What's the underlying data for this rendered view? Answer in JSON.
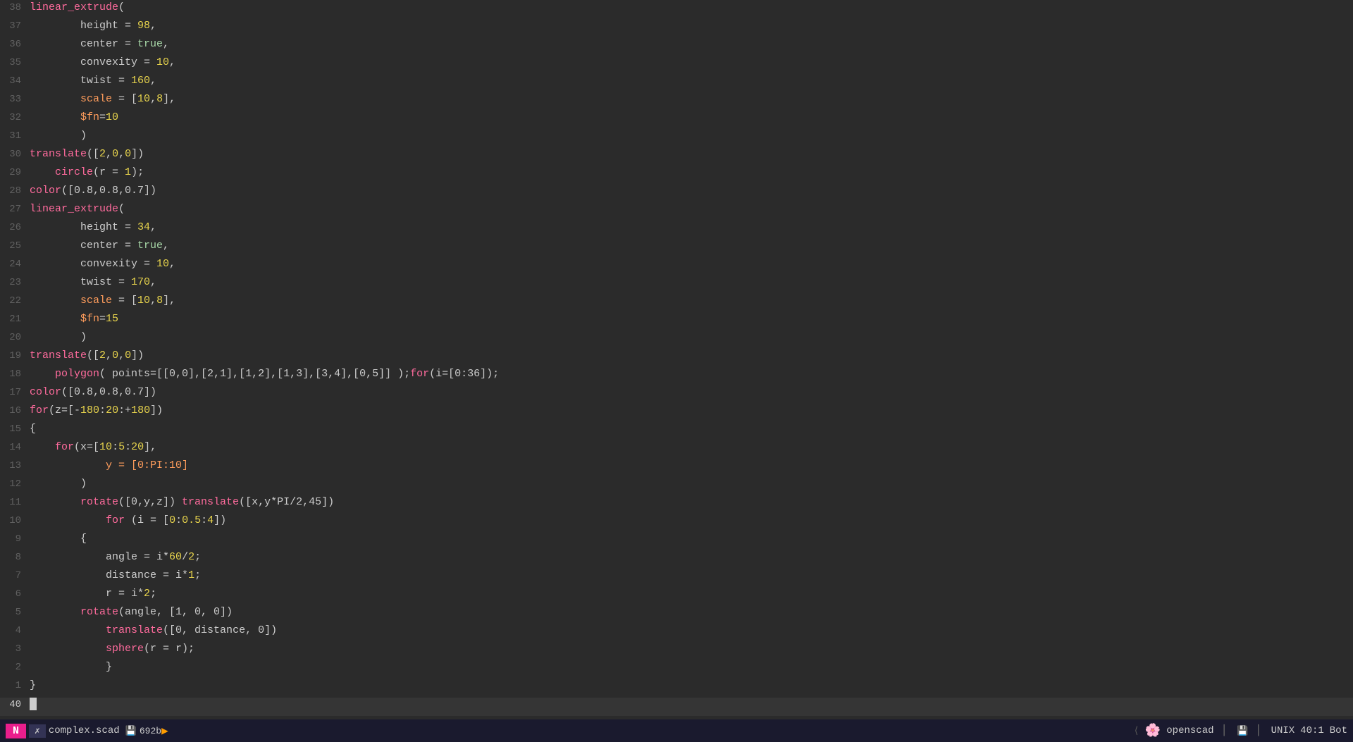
{
  "editor": {
    "background": "#2b2b2b",
    "lines": [
      {
        "num": 1,
        "content": [
          {
            "text": "}",
            "class": "kw-paren"
          }
        ]
      },
      {
        "num": 2,
        "content": [
          {
            "text": "        }",
            "class": "kw-paren"
          }
        ]
      },
      {
        "num": 3,
        "content": [
          {
            "text": "        ",
            "class": "kw-normal"
          },
          {
            "text": "sphere",
            "class": "kw-func"
          },
          {
            "text": "(r = r);",
            "class": "kw-normal"
          }
        ]
      },
      {
        "num": 4,
        "content": [
          {
            "text": "        ",
            "class": "kw-normal"
          },
          {
            "text": "translate",
            "class": "kw-func"
          },
          {
            "text": "([0, distance, 0])",
            "class": "kw-normal"
          }
        ]
      },
      {
        "num": 5,
        "content": [
          {
            "text": "    ",
            "class": "kw-normal"
          },
          {
            "text": "rotate",
            "class": "kw-func"
          },
          {
            "text": "(angle, [1, 0, 0])",
            "class": "kw-normal"
          }
        ]
      },
      {
        "num": 6,
        "content": [
          {
            "text": "        r = i",
            "class": "kw-normal"
          },
          {
            "text": "*",
            "class": "kw-normal"
          },
          {
            "text": "2",
            "class": "kw-val-num"
          },
          {
            "text": ";",
            "class": "kw-normal"
          }
        ]
      },
      {
        "num": 7,
        "content": [
          {
            "text": "        distance = i",
            "class": "kw-normal"
          },
          {
            "text": "*",
            "class": "kw-normal"
          },
          {
            "text": "1",
            "class": "kw-val-num"
          },
          {
            "text": ";",
            "class": "kw-normal"
          }
        ]
      },
      {
        "num": 8,
        "content": [
          {
            "text": "        angle = i",
            "class": "kw-normal"
          },
          {
            "text": "*",
            "class": "kw-normal"
          },
          {
            "text": "60",
            "class": "kw-val-num"
          },
          {
            "text": "/",
            "class": "kw-normal"
          },
          {
            "text": "2",
            "class": "kw-val-num"
          },
          {
            "text": ";",
            "class": "kw-normal"
          }
        ]
      },
      {
        "num": 9,
        "content": [
          {
            "text": "        {",
            "class": "kw-paren"
          }
        ]
      },
      {
        "num": 10,
        "content": [
          {
            "text": "            ",
            "class": "kw-normal"
          },
          {
            "text": "for",
            "class": "kw-func"
          },
          {
            "text": " (i = [",
            "class": "kw-normal"
          },
          {
            "text": "0",
            "class": "kw-val-num"
          },
          {
            "text": ":",
            "class": "kw-normal"
          },
          {
            "text": "0.5",
            "class": "kw-val-num"
          },
          {
            "text": ":",
            "class": "kw-normal"
          },
          {
            "text": "4",
            "class": "kw-val-num"
          },
          {
            "text": "])",
            "class": "kw-normal"
          }
        ]
      },
      {
        "num": 11,
        "content": [
          {
            "text": "        ",
            "class": "kw-normal"
          },
          {
            "text": "rotate",
            "class": "kw-func"
          },
          {
            "text": "([0,y,z]) ",
            "class": "kw-normal"
          },
          {
            "text": "translate",
            "class": "kw-func"
          },
          {
            "text": "([x,y*PI/2,45])",
            "class": "kw-normal"
          }
        ]
      },
      {
        "num": 12,
        "content": [
          {
            "text": "    )",
            "class": "kw-paren"
          }
        ]
      },
      {
        "num": 13,
        "content": [
          {
            "text": "        y = [0:PI:10]",
            "class": "kw-special"
          }
        ]
      },
      {
        "num": 14,
        "content": [
          {
            "text": "    ",
            "class": "kw-normal"
          },
          {
            "text": "for",
            "class": "kw-func"
          },
          {
            "text": "(x=[",
            "class": "kw-normal"
          },
          {
            "text": "10",
            "class": "kw-val-num"
          },
          {
            "text": ":",
            "class": "kw-normal"
          },
          {
            "text": "5",
            "class": "kw-val-num"
          },
          {
            "text": ":",
            "class": "kw-normal"
          },
          {
            "text": "20",
            "class": "kw-val-num"
          },
          {
            "text": "],",
            "class": "kw-normal"
          }
        ]
      },
      {
        "num": 15,
        "content": [
          {
            "text": "{",
            "class": "kw-paren"
          }
        ]
      },
      {
        "num": 16,
        "content": [
          {
            "text": "for",
            "class": "kw-func"
          },
          {
            "text": "(z=[-",
            "class": "kw-normal"
          },
          {
            "text": "180",
            "class": "kw-val-num"
          },
          {
            "text": ":",
            "class": "kw-normal"
          },
          {
            "text": "20",
            "class": "kw-val-num"
          },
          {
            "text": ":+",
            "class": "kw-normal"
          },
          {
            "text": "180",
            "class": "kw-val-num"
          },
          {
            "text": "])",
            "class": "kw-normal"
          }
        ]
      },
      {
        "num": 17,
        "content": [
          {
            "text": "color",
            "class": "kw-func"
          },
          {
            "text": "([0.8,0.8,0.7])",
            "class": "kw-normal"
          }
        ]
      },
      {
        "num": 18,
        "content": [
          {
            "text": "    ",
            "class": "kw-normal"
          },
          {
            "text": "polygon",
            "class": "kw-func"
          },
          {
            "text": "( points=[[0,0],[2,1],[1,2],[1,3],[3,4],[0,5]] );",
            "class": "kw-normal"
          },
          {
            "text": "for",
            "class": "kw-func"
          },
          {
            "text": "(i=[0:36]);",
            "class": "kw-normal"
          }
        ]
      },
      {
        "num": 19,
        "content": [
          {
            "text": "translate",
            "class": "kw-func"
          },
          {
            "text": "([2,0,0])",
            "class": "kw-normal"
          }
        ]
      },
      {
        "num": 20,
        "content": [
          {
            "text": "    )",
            "class": "kw-paren"
          }
        ]
      },
      {
        "num": 21,
        "content": [
          {
            "text": "        ",
            "class": "kw-normal"
          },
          {
            "text": "$fn",
            "class": "kw-var"
          },
          {
            "text": "=",
            "class": "kw-equals"
          },
          {
            "text": "15",
            "class": "kw-val-num"
          }
        ]
      },
      {
        "num": 22,
        "content": [
          {
            "text": "        ",
            "class": "kw-normal"
          },
          {
            "text": "scale",
            "class": "kw-prop"
          },
          {
            "text": " = [",
            "class": "kw-normal"
          },
          {
            "text": "10",
            "class": "kw-val-num"
          },
          {
            "text": ",",
            "class": "kw-normal"
          },
          {
            "text": "8",
            "class": "kw-val-num"
          },
          {
            "text": "],",
            "class": "kw-normal"
          }
        ]
      },
      {
        "num": 23,
        "content": [
          {
            "text": "        ",
            "class": "kw-normal"
          },
          {
            "text": "twist",
            "class": "kw-prop"
          },
          {
            "text": " = ",
            "class": "kw-normal"
          },
          {
            "text": "170",
            "class": "kw-val-num"
          },
          {
            "text": ",",
            "class": "kw-normal"
          }
        ]
      },
      {
        "num": 24,
        "content": [
          {
            "text": "        ",
            "class": "kw-normal"
          },
          {
            "text": "convexity",
            "class": "kw-prop"
          },
          {
            "text": " = ",
            "class": "kw-normal"
          },
          {
            "text": "10",
            "class": "kw-val-num"
          },
          {
            "text": ",",
            "class": "kw-normal"
          }
        ]
      },
      {
        "num": 25,
        "content": [
          {
            "text": "        ",
            "class": "kw-normal"
          },
          {
            "text": "center",
            "class": "kw-prop"
          },
          {
            "text": " = ",
            "class": "kw-normal"
          },
          {
            "text": "true",
            "class": "kw-val-true"
          },
          {
            "text": ",",
            "class": "kw-normal"
          }
        ]
      },
      {
        "num": 26,
        "content": [
          {
            "text": "        ",
            "class": "kw-normal"
          },
          {
            "text": "height",
            "class": "kw-prop"
          },
          {
            "text": " = ",
            "class": "kw-normal"
          },
          {
            "text": "34",
            "class": "kw-val-num"
          },
          {
            "text": ",",
            "class": "kw-normal"
          }
        ]
      },
      {
        "num": 27,
        "content": [
          {
            "text": "linear_extrude",
            "class": "kw-func"
          },
          {
            "text": "(",
            "class": "kw-paren"
          }
        ]
      },
      {
        "num": 28,
        "content": [
          {
            "text": "color",
            "class": "kw-func"
          },
          {
            "text": "([0.8,0.8,0.7])",
            "class": "kw-normal"
          }
        ]
      },
      {
        "num": 29,
        "content": [
          {
            "text": "    ",
            "class": "kw-normal"
          },
          {
            "text": "circle",
            "class": "kw-func"
          },
          {
            "text": "(r = ",
            "class": "kw-normal"
          },
          {
            "text": "1",
            "class": "kw-val-num"
          },
          {
            "text": ");",
            "class": "kw-normal"
          }
        ]
      },
      {
        "num": 30,
        "content": [
          {
            "text": "translate",
            "class": "kw-func"
          },
          {
            "text": "([",
            "class": "kw-normal"
          },
          {
            "text": "2",
            "class": "kw-val-num"
          },
          {
            "text": ",",
            "class": "kw-normal"
          },
          {
            "text": "0",
            "class": "kw-val-num"
          },
          {
            "text": ",",
            "class": "kw-normal"
          },
          {
            "text": "0",
            "class": "kw-val-num"
          },
          {
            "text": "])",
            "class": "kw-normal"
          }
        ]
      },
      {
        "num": 31,
        "content": [
          {
            "text": "    )",
            "class": "kw-paren"
          }
        ]
      },
      {
        "num": 32,
        "content": [
          {
            "text": "        ",
            "class": "kw-normal"
          },
          {
            "text": "$fn",
            "class": "kw-var"
          },
          {
            "text": "=",
            "class": "kw-equals"
          },
          {
            "text": "10",
            "class": "kw-val-num"
          }
        ]
      },
      {
        "num": 33,
        "content": [
          {
            "text": "        ",
            "class": "kw-normal"
          },
          {
            "text": "scale",
            "class": "kw-prop"
          },
          {
            "text": " = [",
            "class": "kw-normal"
          },
          {
            "text": "10",
            "class": "kw-val-num"
          },
          {
            "text": ",",
            "class": "kw-normal"
          },
          {
            "text": "8",
            "class": "kw-val-num"
          },
          {
            "text": "],",
            "class": "kw-normal"
          }
        ]
      },
      {
        "num": 34,
        "content": [
          {
            "text": "        ",
            "class": "kw-normal"
          },
          {
            "text": "twist",
            "class": "kw-prop"
          },
          {
            "text": " = ",
            "class": "kw-normal"
          },
          {
            "text": "160",
            "class": "kw-val-num"
          },
          {
            "text": ",",
            "class": "kw-normal"
          }
        ]
      },
      {
        "num": 35,
        "content": [
          {
            "text": "        ",
            "class": "kw-normal"
          },
          {
            "text": "convexity",
            "class": "kw-prop"
          },
          {
            "text": " = ",
            "class": "kw-normal"
          },
          {
            "text": "10",
            "class": "kw-val-num"
          },
          {
            "text": ",",
            "class": "kw-normal"
          }
        ]
      },
      {
        "num": 36,
        "content": [
          {
            "text": "        ",
            "class": "kw-normal"
          },
          {
            "text": "center",
            "class": "kw-prop"
          },
          {
            "text": " = ",
            "class": "kw-normal"
          },
          {
            "text": "true",
            "class": "kw-val-true"
          },
          {
            "text": ",",
            "class": "kw-normal"
          }
        ]
      },
      {
        "num": 37,
        "content": [
          {
            "text": "        ",
            "class": "kw-normal"
          },
          {
            "text": "height",
            "class": "kw-prop"
          },
          {
            "text": " = ",
            "class": "kw-normal"
          },
          {
            "text": "98",
            "class": "kw-val-num"
          },
          {
            "text": ",",
            "class": "kw-normal"
          }
        ]
      },
      {
        "num": 38,
        "content": [
          {
            "text": "linear_extrude",
            "class": "kw-func"
          },
          {
            "text": "(",
            "class": "kw-paren"
          }
        ]
      },
      {
        "num": 40,
        "content": [
          {
            "text": "▋",
            "class": "kw-normal"
          }
        ],
        "cursor": true
      }
    ]
  },
  "statusbar": {
    "mode": "N",
    "icon1": "✗",
    "filename": "complex.scad",
    "filesize": "692b",
    "plugin_icon": "🌸",
    "plugin_name": "openscad",
    "unix_label": "UNIX",
    "position": "40:1",
    "bot_label": "Bot"
  }
}
